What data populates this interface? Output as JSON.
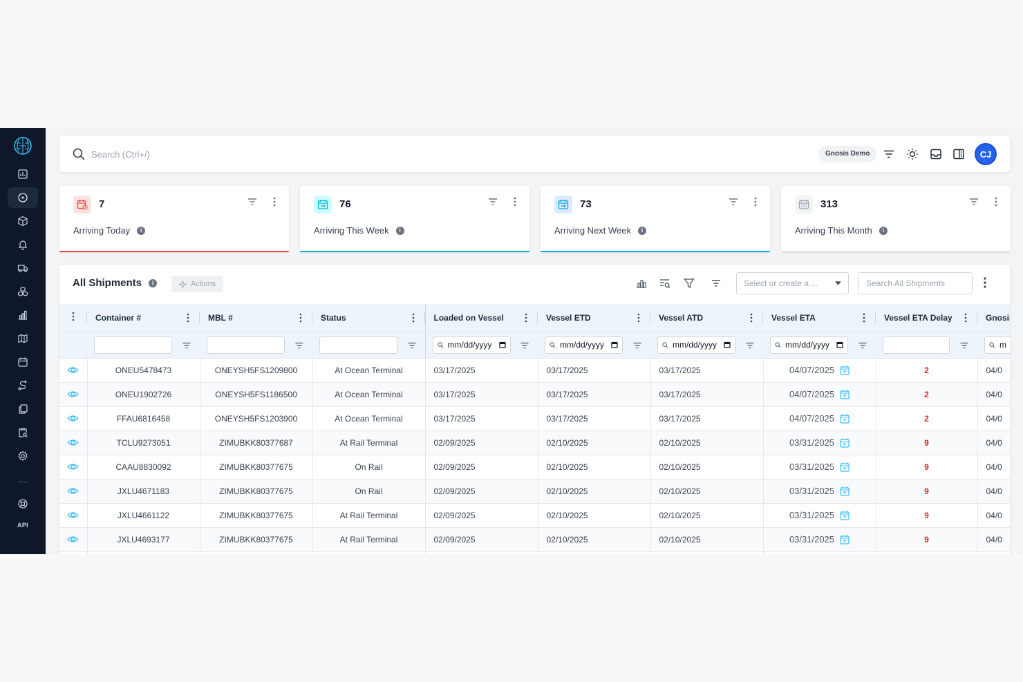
{
  "search": {
    "placeholder": "Search (Ctrl+/)"
  },
  "header": {
    "org_name": "Gnosis Demo",
    "avatar_initials": "CJ"
  },
  "sidebar": {
    "items": [
      "dashboard-icon",
      "explore-icon",
      "package-icon",
      "bell-icon",
      "truck-icon",
      "boxes-icon",
      "bar-chart-icon",
      "map-pin-icon",
      "calendar-icon",
      "route-icon",
      "documents-icon",
      "clipboard-search-icon",
      "settings-icon",
      "help-icon"
    ],
    "api_label": "API"
  },
  "cards": [
    {
      "value": "7",
      "label": "Arriving Today",
      "accent": "#ef4444"
    },
    {
      "value": "76",
      "label": "Arriving This Week",
      "accent": "#06b6d4"
    },
    {
      "value": "73",
      "label": "Arriving Next Week",
      "accent": "#0ea5e9"
    },
    {
      "value": "313",
      "label": "Arriving This Month",
      "accent": "#e5e7eb"
    }
  ],
  "table_panel": {
    "title": "All Shipments",
    "actions_label": "Actions",
    "view_select_placeholder": "Select or create a ...",
    "search_placeholder": "Search All Shipments"
  },
  "table": {
    "columns": [
      "Container #",
      "MBL #",
      "Status",
      "Loaded on Vessel",
      "Vessel ETD",
      "Vessel ATD",
      "Vessel ETA",
      "Vessel ETA Delay",
      "Gnosis"
    ],
    "date_placeholder": "mm/dd/yyyy",
    "rows": [
      {
        "container": "ONEU5478473",
        "mbl": "ONEYSH5FS1209800",
        "status": "At Ocean Terminal",
        "loaded": "03/17/2025",
        "etd": "03/17/2025",
        "atd": "03/17/2025",
        "eta": "04/07/2025",
        "delay": "2",
        "gnosis": "04/0"
      },
      {
        "container": "ONEU1902726",
        "mbl": "ONEYSH5FS1186500",
        "status": "At Ocean Terminal",
        "loaded": "03/17/2025",
        "etd": "03/17/2025",
        "atd": "03/17/2025",
        "eta": "04/07/2025",
        "delay": "2",
        "gnosis": "04/0"
      },
      {
        "container": "FFAU6816458",
        "mbl": "ONEYSH5FS1203900",
        "status": "At Ocean Terminal",
        "loaded": "03/17/2025",
        "etd": "03/17/2025",
        "atd": "03/17/2025",
        "eta": "04/07/2025",
        "delay": "2",
        "gnosis": "04/0"
      },
      {
        "container": "TCLU9273051",
        "mbl": "ZIMUBKK80377687",
        "status": "At Rail Terminal",
        "loaded": "02/09/2025",
        "etd": "02/10/2025",
        "atd": "02/10/2025",
        "eta": "03/31/2025",
        "delay": "9",
        "gnosis": "04/0"
      },
      {
        "container": "CAAU8830092",
        "mbl": "ZIMUBKK80377675",
        "status": "On Rail",
        "loaded": "02/09/2025",
        "etd": "02/10/2025",
        "atd": "02/10/2025",
        "eta": "03/31/2025",
        "delay": "9",
        "gnosis": "04/0"
      },
      {
        "container": "JXLU4671183",
        "mbl": "ZIMUBKK80377675",
        "status": "On Rail",
        "loaded": "02/09/2025",
        "etd": "02/10/2025",
        "atd": "02/10/2025",
        "eta": "03/31/2025",
        "delay": "9",
        "gnosis": "04/0"
      },
      {
        "container": "JXLU4661122",
        "mbl": "ZIMUBKK80377675",
        "status": "At Rail Terminal",
        "loaded": "02/09/2025",
        "etd": "02/10/2025",
        "atd": "02/10/2025",
        "eta": "03/31/2025",
        "delay": "9",
        "gnosis": "04/0"
      },
      {
        "container": "JXLU4693177",
        "mbl": "ZIMUBKK80377675",
        "status": "At Rail Terminal",
        "loaded": "02/09/2025",
        "etd": "02/10/2025",
        "atd": "02/10/2025",
        "eta": "03/31/2025",
        "delay": "9",
        "gnosis": "04/0"
      },
      {
        "container": "",
        "mbl": "",
        "status": "",
        "loaded": "",
        "etd": "",
        "atd": "",
        "eta": "",
        "delay": "",
        "gnosis": ""
      }
    ]
  }
}
